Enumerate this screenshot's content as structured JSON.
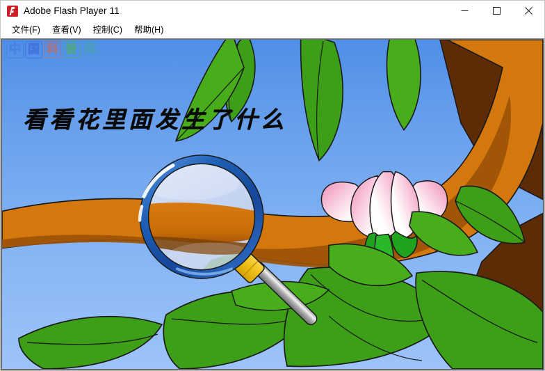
{
  "window": {
    "title": "Adobe Flash Player 11",
    "icon": "flash-player-icon",
    "controls": {
      "minimize": "─",
      "maximize": "□",
      "close": "✕"
    }
  },
  "menu": {
    "items": [
      {
        "label": "文件(F)",
        "name": "menu-file"
      },
      {
        "label": "查看(V)",
        "name": "menu-view"
      },
      {
        "label": "控制(C)",
        "name": "menu-control"
      },
      {
        "label": "帮助(H)",
        "name": "menu-help"
      }
    ]
  },
  "stage": {
    "title": "看看花里面发生了什么",
    "watermark": {
      "chars": [
        {
          "ch": "中",
          "color": "#3b7ae4"
        },
        {
          "ch": "国",
          "color": "#3b5fd8"
        },
        {
          "ch": "科",
          "color": "#e0603f"
        },
        {
          "ch": "普",
          "color": "#4bb84b"
        },
        {
          "ch": "网",
          "color": "#46a8a0"
        }
      ]
    },
    "colors": {
      "sky_top": "#4f8fe8",
      "sky_bottom": "#9dc4f8",
      "branch_light": "#d4780e",
      "branch_dark": "#5d2c07",
      "leaf_green": "#3d9e18",
      "leaf_green_dark": "#2d8209",
      "petal_pink": "#f09bc0",
      "petal_white": "#ffffff",
      "lens_rim": "#1d5fb4",
      "lens_glass": "#c3d4f2",
      "handle_gold": "#f5c518",
      "handle_silver": "#b8b8b8",
      "outline": "#1a1a1a"
    },
    "scene_objects": [
      "tree-branch",
      "leaves",
      "flower",
      "magnifying-glass"
    ]
  }
}
